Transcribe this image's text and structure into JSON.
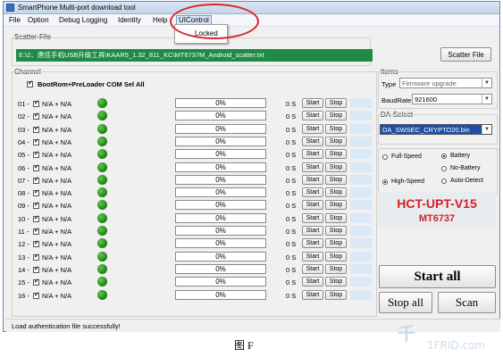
{
  "window": {
    "title": "SmartPhone Multi-port download tool"
  },
  "menu": {
    "file": "File",
    "option": "Option",
    "debug": "Debug Logging",
    "identity": "Identity",
    "help": "Help",
    "uicontrol": "UIControl"
  },
  "dropdown": {
    "locked": "Locked"
  },
  "scatter": {
    "label": "Scatter-File",
    "path": "E:\\2、唐佳手机USB升级工具\\KAAR5_1.32_811_KC\\MT6737M_Android_scatter.txt",
    "button": "Scatter File"
  },
  "channel": {
    "label": "Channel",
    "com_sel": "BootRom+PreLoader COM Sel All"
  },
  "rows": [
    {
      "idx": "01 -",
      "na": "N/A + N/A",
      "progress": "0%",
      "time": "0 S",
      "start": "Start",
      "stop": "Stop"
    },
    {
      "idx": "02 -",
      "na": "N/A + N/A",
      "progress": "0%",
      "time": "0 S",
      "start": "Start",
      "stop": "Stop"
    },
    {
      "idx": "03 -",
      "na": "N/A + N/A",
      "progress": "0%",
      "time": "0 S",
      "start": "Start",
      "stop": "Stop"
    },
    {
      "idx": "04 -",
      "na": "N/A + N/A",
      "progress": "0%",
      "time": "0 S",
      "start": "Start",
      "stop": "Stop"
    },
    {
      "idx": "05 -",
      "na": "N/A + N/A",
      "progress": "0%",
      "time": "0 S",
      "start": "Start",
      "stop": "Stop"
    },
    {
      "idx": "06 -",
      "na": "N/A + N/A",
      "progress": "0%",
      "time": "0 S",
      "start": "Start",
      "stop": "Stop"
    },
    {
      "idx": "07 -",
      "na": "N/A + N/A",
      "progress": "0%",
      "time": "0 S",
      "start": "Start",
      "stop": "Stop"
    },
    {
      "idx": "08 -",
      "na": "N/A + N/A",
      "progress": "0%",
      "time": "0 S",
      "start": "Start",
      "stop": "Stop"
    },
    {
      "idx": "09 -",
      "na": "N/A + N/A",
      "progress": "0%",
      "time": "0 S",
      "start": "Start",
      "stop": "Stop"
    },
    {
      "idx": "10 -",
      "na": "N/A + N/A",
      "progress": "0%",
      "time": "0 S",
      "start": "Start",
      "stop": "Stop"
    },
    {
      "idx": "11 -",
      "na": "N/A + N/A",
      "progress": "0%",
      "time": "0 S",
      "start": "Start",
      "stop": "Stop"
    },
    {
      "idx": "12 -",
      "na": "N/A + N/A",
      "progress": "0%",
      "time": "0 S",
      "start": "Start",
      "stop": "Stop"
    },
    {
      "idx": "13 -",
      "na": "N/A + N/A",
      "progress": "0%",
      "time": "0 S",
      "start": "Start",
      "stop": "Stop"
    },
    {
      "idx": "14 -",
      "na": "N/A + N/A",
      "progress": "0%",
      "time": "0 S",
      "start": "Start",
      "stop": "Stop"
    },
    {
      "idx": "15 -",
      "na": "N/A + N/A",
      "progress": "0%",
      "time": "0 S",
      "start": "Start",
      "stop": "Stop"
    },
    {
      "idx": "16 -",
      "na": "N/A + N/A",
      "progress": "0%",
      "time": "0 S",
      "start": "Start",
      "stop": "Stop"
    }
  ],
  "items": {
    "label": "Items",
    "type_label": "Type",
    "type_value": "Firmware upgrade",
    "baud_label": "BaudRate",
    "baud_value": "921600"
  },
  "da": {
    "label": "DA-Select",
    "value": "DA_SWSEC_CRYPTO20.bin"
  },
  "options": {
    "full_speed": "Full-Speed",
    "high_speed": "High-Speed",
    "battery": "Battery",
    "no_battery": "No-Battery",
    "auto_detect": "Auto-Detect"
  },
  "brand": {
    "line1": "HCT-UPT-V15",
    "line2": "MT6737"
  },
  "buttons": {
    "start_all": "Start all",
    "stop_all": "Stop all",
    "scan": "Scan"
  },
  "status": {
    "text": "Load authentication file successfully!"
  },
  "caption": "图 F",
  "watermark": {
    "main": "千",
    "sub": "1FRID.com"
  },
  "colors": {
    "path_bg": "#1f8a45",
    "brand_red": "#d41e24",
    "annotation_red": "#d8262c"
  }
}
